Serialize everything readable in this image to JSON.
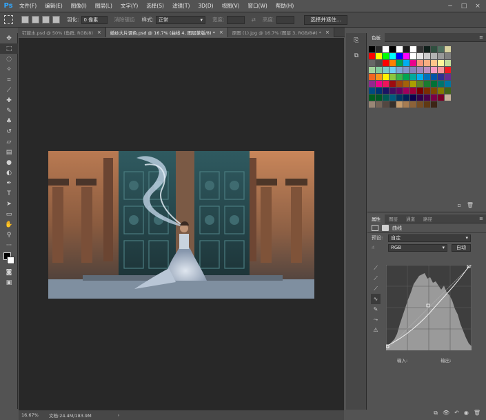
{
  "app": {
    "logo": "Ps",
    "menu": [
      "文件(F)",
      "编辑(E)",
      "图像(I)",
      "图层(L)",
      "文字(Y)",
      "选择(S)",
      "滤镜(T)",
      "3D(D)",
      "视图(V)",
      "窗口(W)",
      "帮助(H)"
    ],
    "window_controls": [
      "−",
      "□",
      "×"
    ]
  },
  "options": {
    "feather_label": "羽化:",
    "feather_value": "0 像素",
    "antialias_label": "消除锯齿",
    "style_label": "样式:",
    "style_value": "正常",
    "width_label": "宽度:",
    "height_label": "高度:",
    "select_mask_button": "选择并遮住..."
  },
  "tabs": [
    {
      "label": "钉鼓水.psd @ 50% (鱼群, RGB/8)",
      "active": false
    },
    {
      "label": "婚纱大片调色.psd @ 16.7% (曲线 4, 图层蒙版/8) *",
      "active": true
    },
    {
      "label": "原图 (1).jpg @ 16.7% (图层 3, RGB/8#) *",
      "active": false
    }
  ],
  "status": {
    "zoom": "16.67%",
    "doc": "文档:24.4M/183.9M",
    "arrow": "›"
  },
  "swatches": {
    "tab": "色板",
    "menu_icon": "≡",
    "colors": [
      [
        "#000000",
        "#2b2b2b",
        "#ffffff",
        "#000000",
        "#ffffff",
        "#1a1a1a",
        "#ffffff",
        "#333333",
        "#0f1f1a",
        "#2f4f3f",
        "#4f6f5f",
        "#d8d2a0"
      ],
      [
        "#ff0000",
        "#ffff00",
        "#00ff00",
        "#00ffff",
        "#0000ff",
        "#ff00ff",
        "#ffffff",
        "#e6e6e6",
        "#cccccc",
        "#b3b3b3",
        "#999999",
        "#808080"
      ],
      [
        "#666666",
        "#4d4d4d",
        "#ff0000",
        "#ff8000",
        "#00a651",
        "#00aeef",
        "#ec008c",
        "#f7977a",
        "#f9ad81",
        "#fdc68a",
        "#fff79a",
        "#c4df9b"
      ],
      [
        "#a3d39c",
        "#82ca9d",
        "#7bcdc8",
        "#6ecff6",
        "#7ea7d8",
        "#8493ca",
        "#8882be",
        "#a187be",
        "#bc8dbf",
        "#f49ac2",
        "#f6989d",
        "#ed1c24"
      ],
      [
        "#f26522",
        "#f7941d",
        "#fff200",
        "#8dc63f",
        "#39b54a",
        "#00a651",
        "#00a99d",
        "#00aeef",
        "#0072bc",
        "#0054a6",
        "#2e3192",
        "#662d91"
      ],
      [
        "#92278f",
        "#ec008c",
        "#ed145b",
        "#9e0b0f",
        "#a0410d",
        "#a36209",
        "#aba000",
        "#598527",
        "#1a7b30",
        "#007236",
        "#00746b",
        "#0076a3"
      ],
      [
        "#004b80",
        "#003471",
        "#1b1464",
        "#440e62",
        "#630460",
        "#9e005d",
        "#9e0039",
        "#790000",
        "#7b2e00",
        "#7d4900",
        "#827b00",
        "#406618"
      ],
      [
        "#005e20",
        "#005826",
        "#005952",
        "#005b7f",
        "#003663",
        "#002157",
        "#0d004c",
        "#32004b",
        "#4b0049",
        "#7b0046",
        "#7a0026",
        "#c7b299"
      ],
      [
        "#998675",
        "#736357",
        "#534741",
        "#37302a",
        "#c69c6d",
        "#a67c52",
        "#8c6239",
        "#754c24",
        "#603913",
        "#3c2415"
      ]
    ],
    "footer_icons": [
      "▫",
      "🗑"
    ]
  },
  "props": {
    "tabs": [
      "属性",
      "图层",
      "通道",
      "路径"
    ],
    "menu_icon": "≡",
    "title": "曲线",
    "preset_label": "预设:",
    "preset_value": "自定",
    "channel_value": "RGB",
    "auto_button": "自动",
    "input_label": "输入:",
    "output_label": "输出:",
    "input_value": "",
    "output_value": "",
    "footer_icons": [
      "⧉",
      "👁",
      "↶",
      "◉",
      "🗑"
    ]
  },
  "colors": {
    "accent": "#31a8ff",
    "canvas_bg": "#282828",
    "panel_bg": "#535353"
  }
}
